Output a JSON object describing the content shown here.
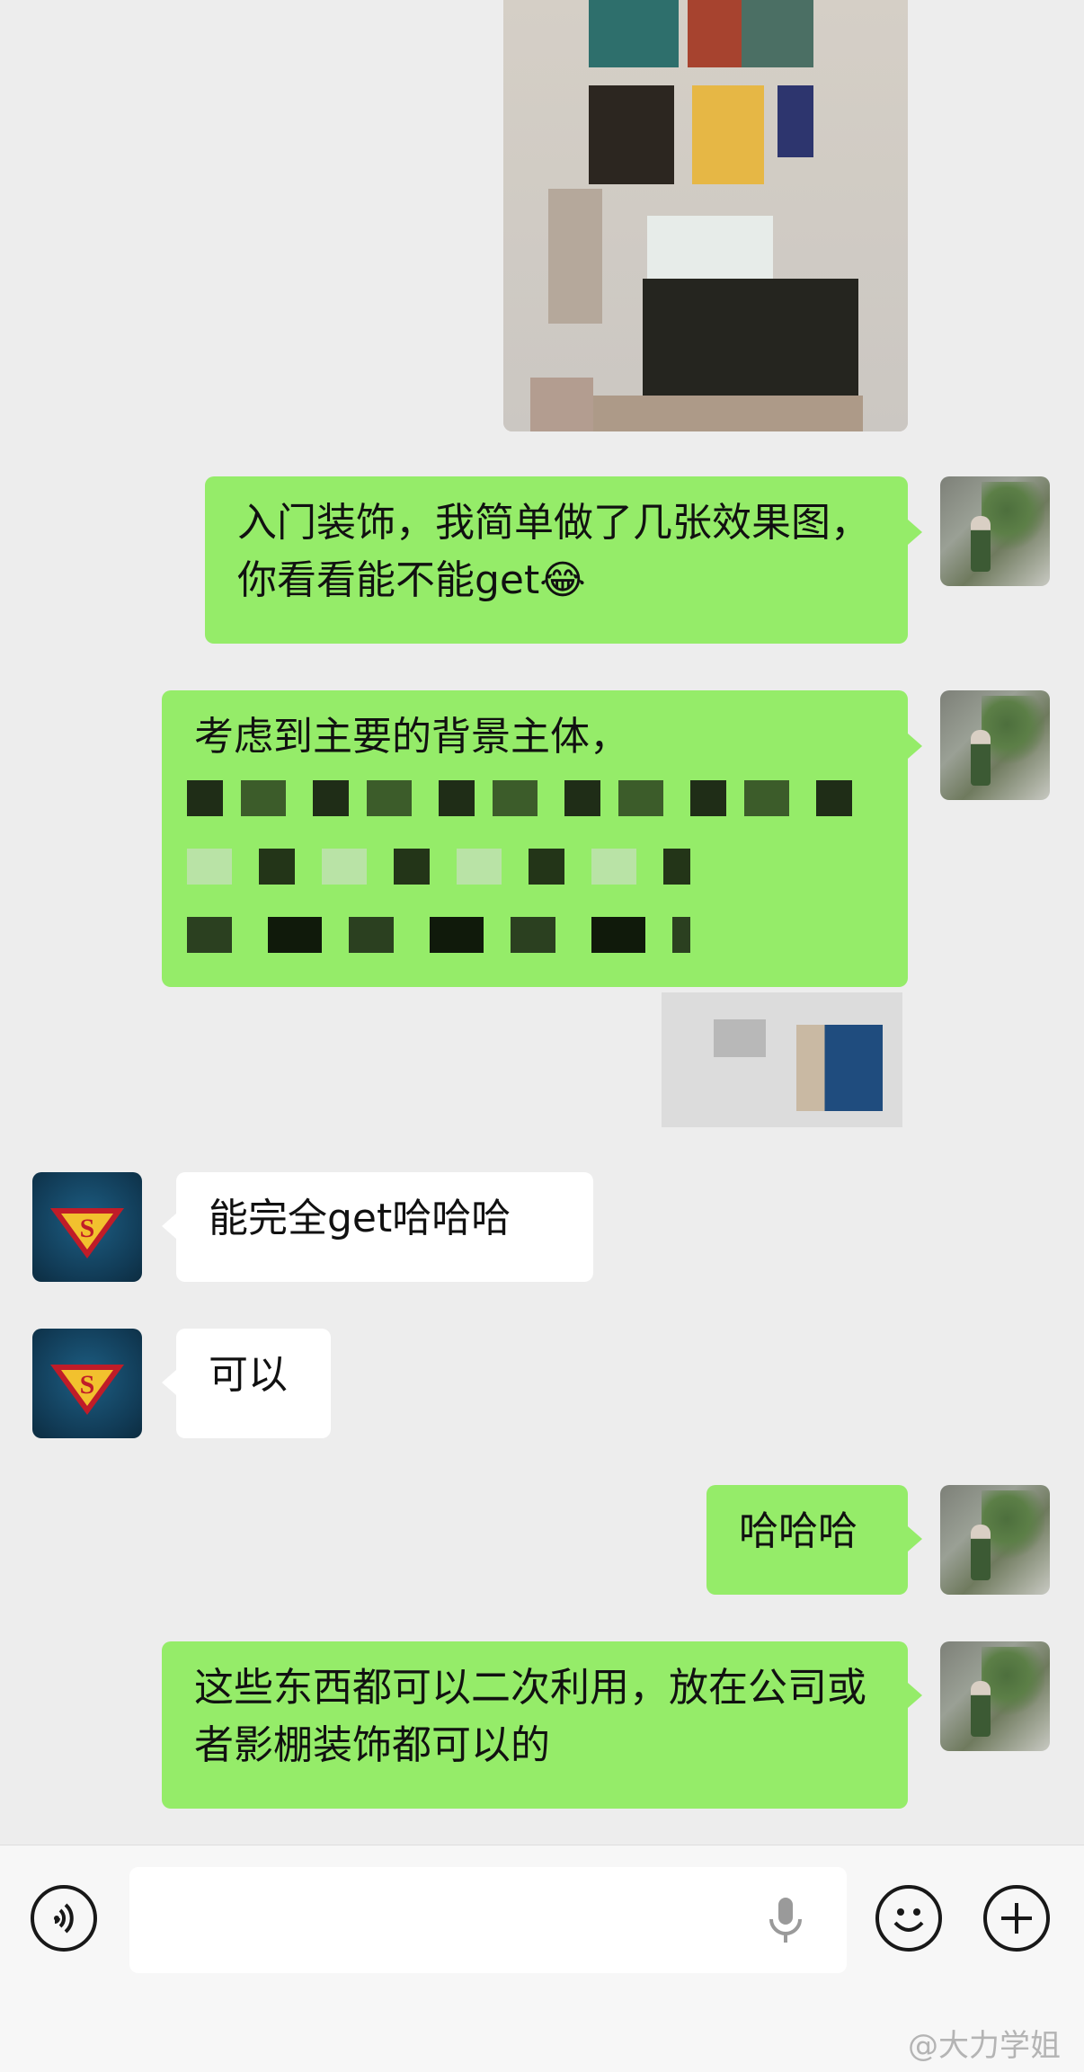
{
  "messages": [
    {
      "id": "m1",
      "side": "right",
      "type": "text",
      "text": "入门装饰，我简单做了几张效果图，你看看能不能get😂"
    },
    {
      "id": "m2",
      "side": "right",
      "type": "text",
      "text": "考虑到主要的背景主体，"
    },
    {
      "id": "m3",
      "side": "left",
      "type": "text",
      "text": "能完全get哈哈哈"
    },
    {
      "id": "m4",
      "side": "left",
      "type": "text",
      "text": "可以"
    },
    {
      "id": "m5",
      "side": "right",
      "type": "text",
      "text": "哈哈哈"
    },
    {
      "id": "m6",
      "side": "right",
      "type": "text",
      "text": "这些东西都可以二次利用，放在公司或者影棚装饰都可以的"
    }
  ],
  "input_bar": {
    "voice_icon": "voice-toggle-icon",
    "mic_icon": "microphone-icon",
    "emoji_icon": "emoji-icon",
    "plus_icon": "plus-icon",
    "placeholder": ""
  },
  "watermark": {
    "text": "@大力学姐"
  },
  "colors": {
    "bubble_self": "#95ec69",
    "bubble_other": "#ffffff",
    "background": "#ededed",
    "input_bar": "#f7f7f7"
  }
}
